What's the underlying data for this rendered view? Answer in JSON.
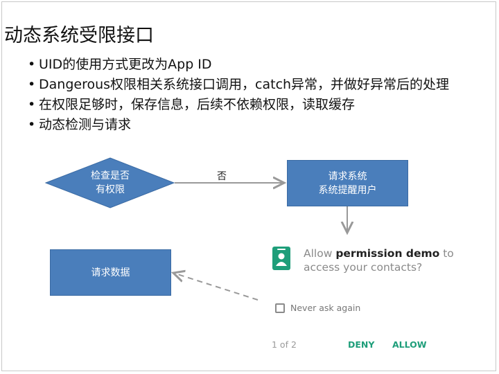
{
  "title": "动态系统受限接口",
  "bullets": [
    "UID的使用方式更改为App ID",
    "Dangerous权限相关系统接口调用，catch异常，并做好异常后的处理",
    "在权限足够时，保存信息，后续不依赖权限，读取缓存",
    "动态检测与请求"
  ],
  "bullet_char": "•",
  "flow": {
    "decision": {
      "line1": "检查是否",
      "line2": "有权限"
    },
    "no_label": "否",
    "request_box": {
      "line1": "请求系统",
      "line2": "系统提醒用户"
    },
    "data_box": "请求数据"
  },
  "dialog": {
    "prefix": "Allow ",
    "app": "permission demo",
    "suffix": " to access your contacts?",
    "never_ask": "Never ask again",
    "pager": "1 of 2",
    "deny": "DENY",
    "allow": "ALLOW",
    "icon": "contact-card-icon"
  },
  "colors": {
    "shape_fill": "#4a7ebb",
    "dialog_accent": "#1e9e7a",
    "arrow": "#999999"
  }
}
